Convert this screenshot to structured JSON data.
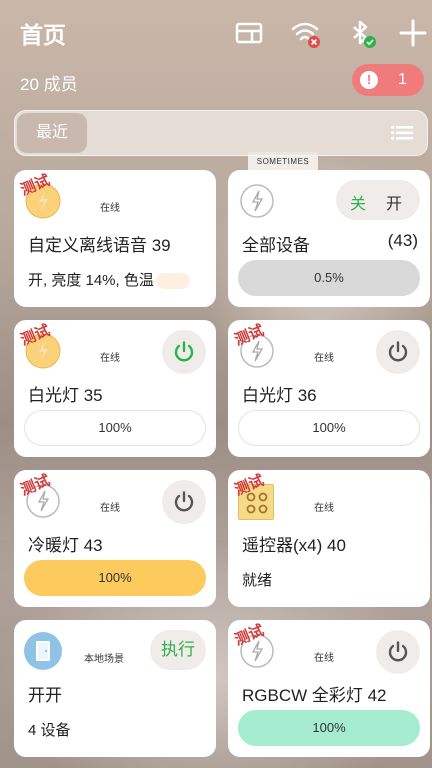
{
  "header": {
    "title": "首页",
    "members": "20 成员",
    "alert_count": "1",
    "alert_symbol": "!",
    "icons": [
      "card-view-icon",
      "wifi-off-icon",
      "bluetooth-connected-icon",
      "add-icon"
    ]
  },
  "filter": {
    "active_tab": "最近"
  },
  "test_stamp": "测试",
  "cards": [
    {
      "icon": "bulb-yellow-icon",
      "status": "在线",
      "name": "自定义离线语音 39",
      "sub": "开, 亮度 14%, 色温"
    },
    {
      "icon": "bulb-outline-icon",
      "name": "全部设备",
      "count": "(43)",
      "off_label": "关",
      "on_label": "开",
      "bar": "0.5%"
    },
    {
      "icon": "bulb-yellow-icon",
      "status": "在线",
      "name": "白光灯 35",
      "bar": "100%"
    },
    {
      "icon": "bulb-outline-icon",
      "status": "在线",
      "name": "白光灯 36",
      "bar": "100%"
    },
    {
      "icon": "bulb-outline-icon",
      "status": "在线",
      "name": "冷暖灯 43",
      "bar": "100%"
    },
    {
      "icon": "remote-icon",
      "status": "在线",
      "name": "遥控器(x4) 40",
      "sub": "就绪"
    },
    {
      "icon": "door-icon",
      "status": "本地场景",
      "name": "开开",
      "sub": "4 设备",
      "action": "执行"
    },
    {
      "icon": "bulb-outline-icon",
      "status": "在线",
      "name": "RGBCW 全彩灯 42",
      "bar": "100%"
    }
  ],
  "colors": {
    "power_on": "#2bb34a",
    "power_off": "#555555",
    "alert": "#f07b7b",
    "bar_yellow": "#fdca5d",
    "bar_green": "#a6ecd0",
    "stamp": "#d23c3c"
  },
  "background": {
    "frame_text": "SOMETIMES"
  }
}
